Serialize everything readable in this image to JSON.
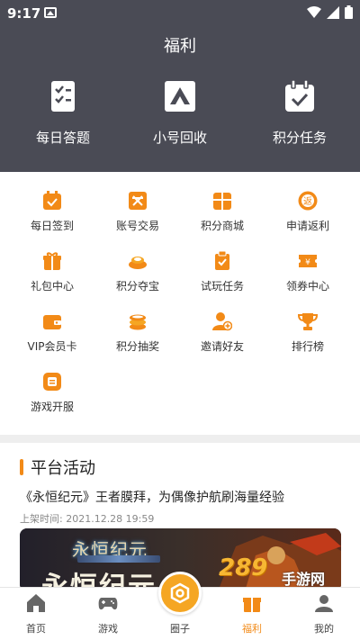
{
  "status_bar": {
    "time": "9:17"
  },
  "header": {
    "title": "福利"
  },
  "top_features": [
    {
      "label": "每日答题",
      "icon": "checklist-icon"
    },
    {
      "label": "小号回收",
      "icon": "recycle-triangle-icon"
    },
    {
      "label": "积分任务",
      "icon": "calendar-check-icon"
    }
  ],
  "grid_items": [
    {
      "label": "每日签到",
      "icon": "calendar-icon"
    },
    {
      "label": "账号交易",
      "icon": "trade-icon"
    },
    {
      "label": "积分商城",
      "icon": "gift-box-icon"
    },
    {
      "label": "申请返利",
      "icon": "rebate-icon"
    },
    {
      "label": "礼包中心",
      "icon": "gift-icon"
    },
    {
      "label": "积分夺宝",
      "icon": "treasure-icon"
    },
    {
      "label": "试玩任务",
      "icon": "clipboard-check-icon"
    },
    {
      "label": "领券中心",
      "icon": "coupon-icon"
    },
    {
      "label": "VIP会员卡",
      "icon": "wallet-icon"
    },
    {
      "label": "积分抽奖",
      "icon": "coins-icon"
    },
    {
      "label": "邀请好友",
      "icon": "add-user-icon"
    },
    {
      "label": "排行榜",
      "icon": "trophy-icon"
    },
    {
      "label": "游戏开服",
      "icon": "server-icon"
    }
  ],
  "activity": {
    "title": "平台活动",
    "news_title": "《永恒纪元》王者膜拜，为偶像护航刷海量经验",
    "date": "上架时间: 2021.12.28 19:59",
    "banner_logo": "永恒纪元",
    "banner_big": "永恒纪元"
  },
  "bottom_nav": [
    {
      "label": "首页",
      "icon": "home-icon"
    },
    {
      "label": "游戏",
      "icon": "gamepad-icon"
    },
    {
      "label": "圈子",
      "icon": "circle-icon"
    },
    {
      "label": "福利",
      "icon": "gift-icon"
    },
    {
      "label": "我的",
      "icon": "user-icon"
    }
  ],
  "watermark": {
    "number": "289",
    "text": "手游网"
  },
  "colors": {
    "header_bg": "#4a4b55",
    "accent": "#f28a17",
    "center_button": "#f5a623"
  }
}
